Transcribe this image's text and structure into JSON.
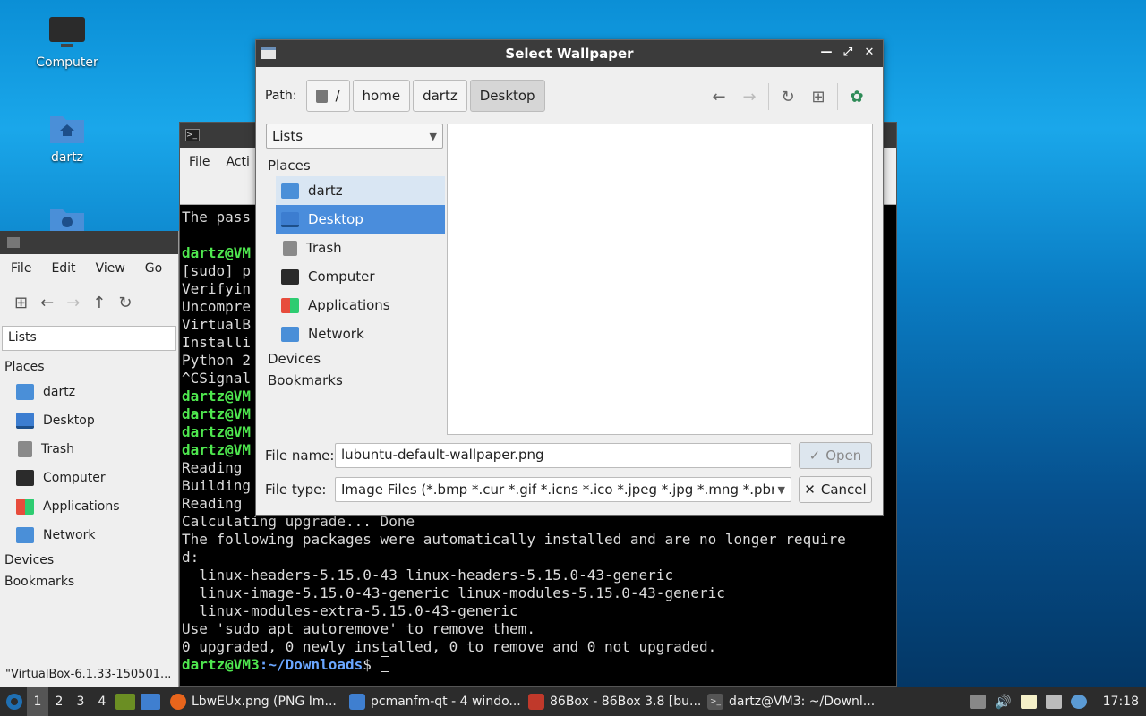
{
  "desktop": {
    "icons": [
      {
        "label": "Computer"
      },
      {
        "label": "dartz"
      },
      {
        "label": ""
      }
    ]
  },
  "file_manager": {
    "menu": [
      "File",
      "Edit",
      "View",
      "Go"
    ],
    "view_mode": "Lists",
    "places_title": "Places",
    "places": [
      {
        "label": "dartz",
        "icon": "home-folder-icon"
      },
      {
        "label": "Desktop",
        "icon": "desktop-icon"
      },
      {
        "label": "Trash",
        "icon": "trash-icon"
      },
      {
        "label": "Computer",
        "icon": "computer-icon"
      },
      {
        "label": "Applications",
        "icon": "applications-icon"
      },
      {
        "label": "Network",
        "icon": "network-icon"
      }
    ],
    "devices": "Devices",
    "bookmarks": "Bookmarks",
    "status": "\"VirtualBox-6.1.33-150501..."
  },
  "terminal": {
    "menu": [
      "File",
      "Acti"
    ],
    "lines": [
      {
        "type": "text",
        "text": "The pass"
      },
      {
        "type": "text",
        "text": ""
      },
      {
        "type": "prompt",
        "prompt": "dartz@VM",
        "rest": ""
      },
      {
        "type": "text",
        "text": "[sudo] p"
      },
      {
        "type": "text",
        "text": "Verifyin"
      },
      {
        "type": "text",
        "text": "Uncompre"
      },
      {
        "type": "text",
        "text": "VirtualB"
      },
      {
        "type": "text",
        "text": "Installi"
      },
      {
        "type": "text",
        "text": "Python 2"
      },
      {
        "type": "text",
        "text": "^CSignal"
      },
      {
        "type": "prompt",
        "prompt": "dartz@VM",
        "rest": ""
      },
      {
        "type": "prompt",
        "prompt": "dartz@VM",
        "rest": ""
      },
      {
        "type": "prompt",
        "prompt": "dartz@VM",
        "rest": ""
      },
      {
        "type": "prompt",
        "prompt": "dartz@VM",
        "rest": ""
      },
      {
        "type": "text",
        "text": "Reading"
      },
      {
        "type": "text",
        "text": "Building"
      },
      {
        "type": "text",
        "text": "Reading"
      },
      {
        "type": "text",
        "text": "Calculating upgrade... Done"
      },
      {
        "type": "text",
        "text": "The following packages were automatically installed and are no longer require"
      },
      {
        "type": "text",
        "text": "d:"
      },
      {
        "type": "text",
        "text": "  linux-headers-5.15.0-43 linux-headers-5.15.0-43-generic"
      },
      {
        "type": "text",
        "text": "  linux-image-5.15.0-43-generic linux-modules-5.15.0-43-generic"
      },
      {
        "type": "text",
        "text": "  linux-modules-extra-5.15.0-43-generic"
      },
      {
        "type": "text",
        "text": "Use 'sudo apt autoremove' to remove them."
      },
      {
        "type": "text",
        "text": "0 upgraded, 0 newly installed, 0 to remove and 0 not upgraded."
      }
    ],
    "final_prompt_user": "dartz@VM3",
    "final_prompt_path": ":~/Downloads",
    "final_prompt_sym": "$ "
  },
  "dialog": {
    "title": "Select Wallpaper",
    "path_label": "Path:",
    "crumbs": [
      "/",
      "home",
      "dartz",
      "Desktop"
    ],
    "view_mode": "Lists",
    "places_title": "Places",
    "places": [
      {
        "label": "dartz",
        "icon": "home-folder-icon"
      },
      {
        "label": "Desktop",
        "icon": "desktop-icon"
      },
      {
        "label": "Trash",
        "icon": "trash-icon"
      },
      {
        "label": "Computer",
        "icon": "computer-icon"
      },
      {
        "label": "Applications",
        "icon": "applications-icon"
      },
      {
        "label": "Network",
        "icon": "network-icon"
      }
    ],
    "devices": "Devices",
    "bookmarks": "Bookmarks",
    "filename_label": "File name:",
    "filename_value": "lubuntu-default-wallpaper.png",
    "filetype_label": "File type:",
    "filetype_value": "Image Files (*.bmp *.cur *.gif *.icns *.ico *.jpeg *.jpg *.mng *.pbm *.pgm",
    "open_label": "Open",
    "cancel_label": "Cancel"
  },
  "taskbar": {
    "workspaces": [
      "1",
      "2",
      "3",
      "4"
    ],
    "active_workspace": "1",
    "tasks": [
      {
        "label": "LbwEUx.png (PNG Im...",
        "color": "#e8651c"
      },
      {
        "label": "pcmanfm-qt - 4 windo...",
        "color": "#3f7fd0"
      },
      {
        "label": "86Box - 86Box 3.8 [bu...",
        "color": "#c0392b"
      },
      {
        "label": "dartz@VM3: ~/Downl...",
        "color": "#555555"
      }
    ],
    "clock": "17:18"
  },
  "colors": {
    "accent": "#4a8ddc",
    "prompt": "#4fe84f",
    "path": "#6aa6ff"
  }
}
